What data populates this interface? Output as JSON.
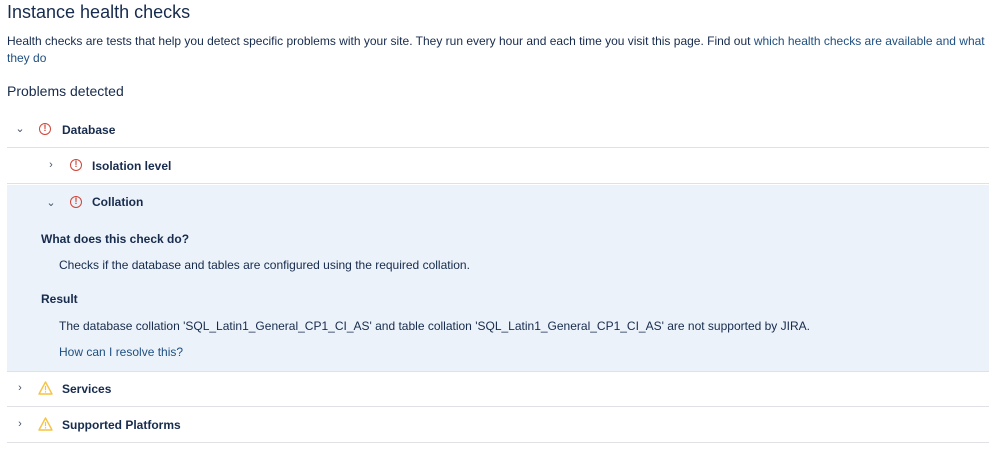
{
  "page": {
    "title": "Instance health checks",
    "intro_text": "Health checks are tests that help you detect specific problems with your site. They run every hour and each time you visit this page. Find out ",
    "intro_link": "which health checks are available and what they do",
    "problems_heading": "Problems detected"
  },
  "checks": {
    "database": {
      "label": "Database",
      "status": "error",
      "expanded": true
    },
    "isolation": {
      "label": "Isolation level",
      "status": "error",
      "expanded": false
    },
    "collation": {
      "label": "Collation",
      "status": "error",
      "expanded": true,
      "what_heading": "What does this check do?",
      "what_text": "Checks if the database and tables are configured using the required collation.",
      "result_heading": "Result",
      "result_text": "The database collation 'SQL_Latin1_General_CP1_CI_AS' and table collation 'SQL_Latin1_General_CP1_CI_AS' are not supported by JIRA.",
      "resolve_link": "How can I resolve this?"
    },
    "services": {
      "label": "Services",
      "status": "warning",
      "expanded": false
    },
    "platforms": {
      "label": "Supported Platforms",
      "status": "warning",
      "expanded": false
    }
  },
  "icons": {
    "chevron_expanded": "chevron-down-icon",
    "chevron_collapsed": "chevron-right-icon",
    "error": "error-circle-icon",
    "warning": "warning-triangle-icon"
  },
  "colors": {
    "link": "#205081",
    "error": "#d04437",
    "warning": "#f6c342",
    "expanded_bg": "#ebf2f9",
    "divider": "#dfe1e6"
  }
}
